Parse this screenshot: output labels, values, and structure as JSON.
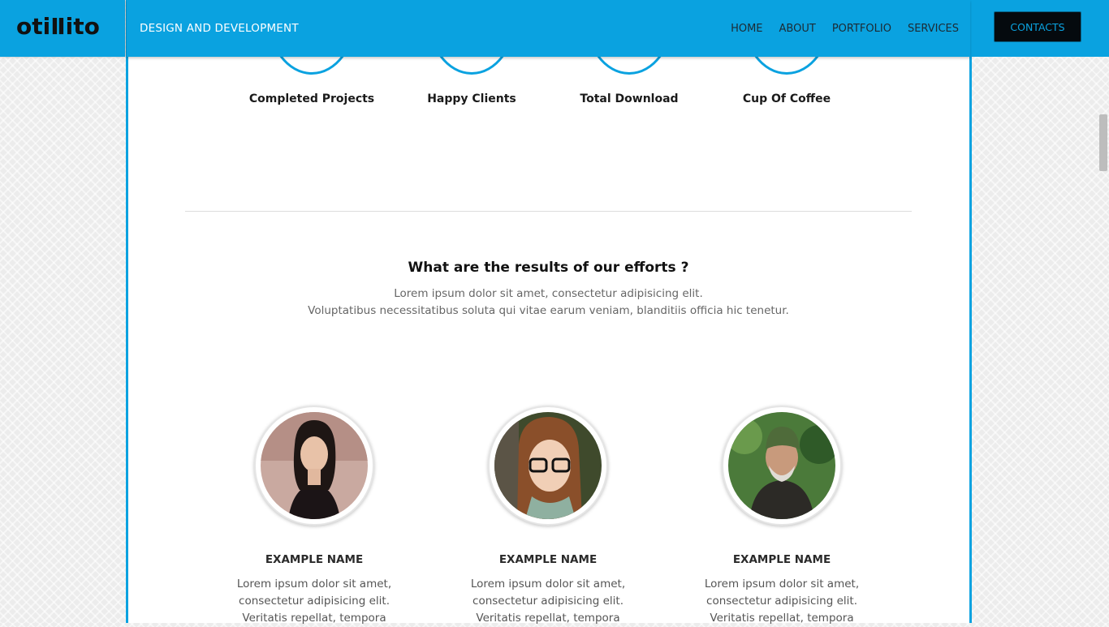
{
  "header": {
    "logo": "otiⅡito",
    "tagline": "DESIGN AND DEVELOPMENT",
    "nav": [
      "HOME",
      "ABOUT",
      "PORTFOLIO",
      "SERVICES"
    ],
    "contacts": "CONTACTS"
  },
  "stats": [
    {
      "label": "Completed Projects"
    },
    {
      "label": "Happy Clients"
    },
    {
      "label": "Total Download"
    },
    {
      "label": "Cup Of Coffee"
    }
  ],
  "results": {
    "title": "What are the results of our efforts ?",
    "line1": "Lorem ipsum dolor sit amet, consectetur adipisicing elit.",
    "line2": "Voluptatibus necessitatibus soluta qui vitae earum veniam, blanditiis officia hic tenetur."
  },
  "team": [
    {
      "name": "EXAMPLE NAME",
      "bio1": "Lorem ipsum dolor sit amet,",
      "bio2": "consectetur adipisicing elit.",
      "bio3": "Veritatis repellat, tempora"
    },
    {
      "name": "EXAMPLE NAME",
      "bio1": "Lorem ipsum dolor sit amet,",
      "bio2": "consectetur adipisicing elit.",
      "bio3": "Veritatis repellat, tempora"
    },
    {
      "name": "EXAMPLE NAME",
      "bio1": "Lorem ipsum dolor sit amet,",
      "bio2": "consectetur adipisicing elit.",
      "bio3": "Veritatis repellat, tempora"
    }
  ],
  "colors": {
    "accent": "#0aa2e0",
    "button": "#050a0e"
  }
}
